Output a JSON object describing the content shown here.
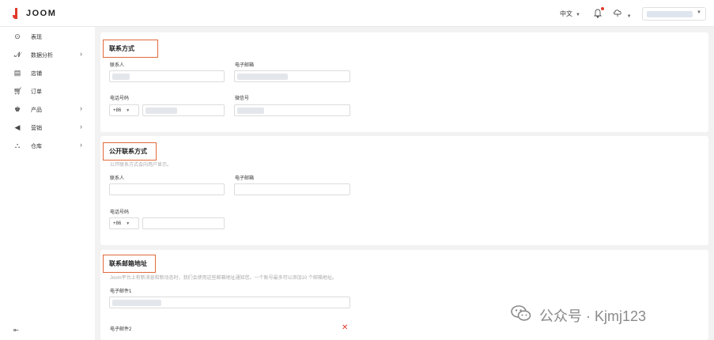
{
  "topbar": {
    "brand": "JOOM",
    "language": "中文",
    "account_name": ""
  },
  "sidebar": {
    "items": [
      {
        "label": "表现",
        "icon": "dashboard-icon",
        "has_arrow": false
      },
      {
        "label": "数据分析",
        "icon": "analytics-icon",
        "has_arrow": true
      },
      {
        "label": "店铺",
        "icon": "store-icon",
        "has_arrow": false
      },
      {
        "label": "订单",
        "icon": "cart-icon",
        "has_arrow": false
      },
      {
        "label": "产品",
        "icon": "product-icon",
        "has_arrow": true
      },
      {
        "label": "营销",
        "icon": "megaphone-icon",
        "has_arrow": true
      },
      {
        "label": "仓库",
        "icon": "warehouse-icon",
        "has_arrow": true
      }
    ],
    "collapse_icon": "collapse-sidebar-icon"
  },
  "contact": {
    "title": "联系方式",
    "contact_person_label": "联系人",
    "email_label": "电子邮箱",
    "phone_label": "电话号码",
    "phone_code": "+86",
    "wechat_label": "微信号"
  },
  "public_contact": {
    "title": "公开联系方式",
    "hint": "公开联系方式会向用户显示。",
    "contact_person_label": "联系人",
    "email_label": "电子邮箱",
    "phone_label": "电话号码",
    "phone_code": "+86"
  },
  "email_addresses": {
    "title": "联系邮箱地址",
    "hint": "Joom平台上有新消息和新动态时，我们会使用这些邮箱地址通知您。一个账号最多可以添加10 个邮箱地址。",
    "email1_label": "电子邮件1",
    "email2_label": "电子邮件2"
  },
  "watermark": {
    "text": "公众号 · Kjmj123"
  },
  "colors": {
    "brand": "#e03a2a",
    "section_highlight": "#e06a3a",
    "background": "#f2f2f2"
  }
}
